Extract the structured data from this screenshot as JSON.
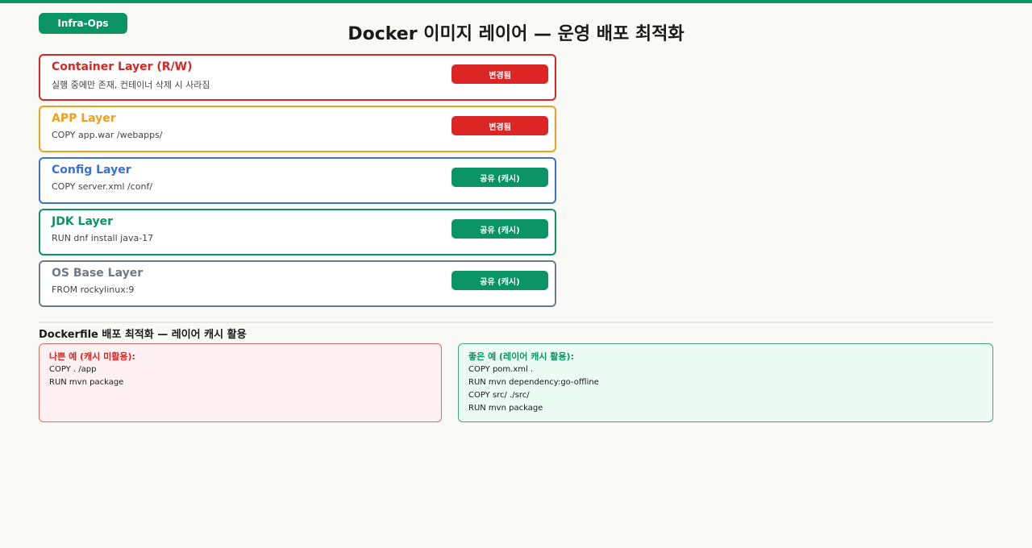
{
  "badge": "Infra-Ops",
  "title": "Docker 이미지 레이어 — 운영 배포 최적화",
  "colors": {
    "accent": "#0a9466",
    "red": "#dc2626",
    "orange": "#f0a01e",
    "blue": "#3a6fd4",
    "green": "#0a9466",
    "gray": "#707a86"
  },
  "layers": [
    {
      "name": "Container Layer (R/W)",
      "desc": "실행 중에만 존재, 컨테이너 삭제 시 사라짐",
      "status": "변경됨",
      "color": "#dc2626",
      "status_color": "#dc2626"
    },
    {
      "name": "APP Layer",
      "desc": "COPY app.war /webapps/",
      "status": "변경됨",
      "color": "#f0a01e",
      "status_color": "#dc2626"
    },
    {
      "name": "Config Layer",
      "desc": "COPY server.xml /conf/",
      "status": "공유 (캐시)",
      "color": "#3a6fd4",
      "status_color": "#0a9466"
    },
    {
      "name": "JDK Layer",
      "desc": "RUN dnf install java-17",
      "status": "공유 (캐시)",
      "color": "#0a9466",
      "status_color": "#0a9466"
    },
    {
      "name": "OS Base Layer",
      "desc": "FROM rockylinux:9",
      "status": "공유 (캐시)",
      "color": "#707a86",
      "status_color": "#0a9466"
    }
  ],
  "section_title": "Dockerfile 배포 최적화 — 레이어 캐시 활용",
  "bad_example": {
    "title": "나쁜 예 (캐시 미활용):",
    "lines": [
      "COPY . /app",
      "RUN mvn package"
    ]
  },
  "good_example": {
    "title": "좋은 예 (레이어 캐시 활용):",
    "lines": [
      "COPY pom.xml .",
      "RUN mvn dependency:go-offline",
      "COPY src/ ./src/",
      "RUN mvn package"
    ]
  }
}
